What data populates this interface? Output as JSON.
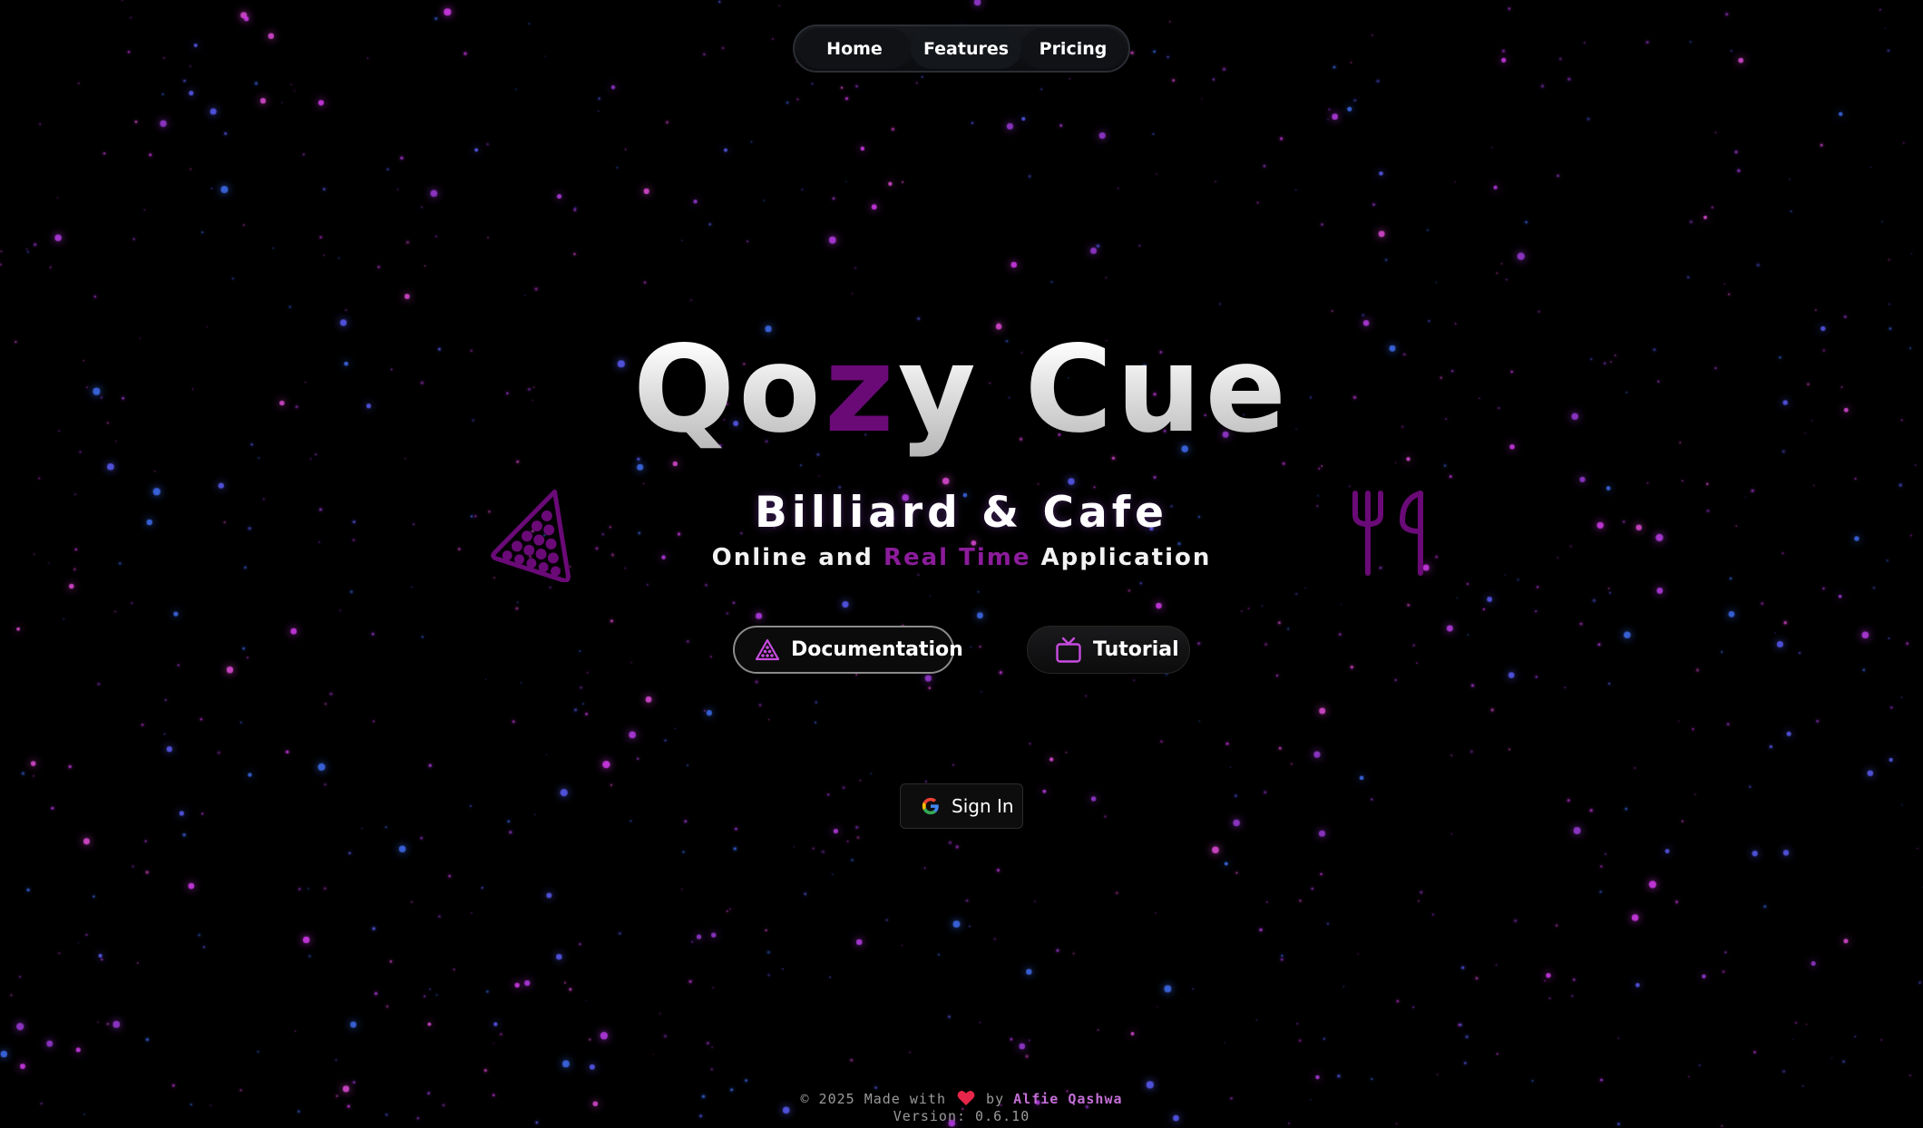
{
  "nav": {
    "items": [
      {
        "label": "Home"
      },
      {
        "label": "Features"
      },
      {
        "label": "Pricing"
      }
    ]
  },
  "hero": {
    "title_part1": "Qo",
    "title_accent": "z",
    "title_part2": "y Cue",
    "subtitle": "Billiard & Cafe",
    "tagline_pre": "Online and ",
    "tagline_accent": "Real Time",
    "tagline_post": " Application"
  },
  "buttons": {
    "documentation": "Documentation",
    "tutorial": "Tutorial",
    "sign_in": "Sign In"
  },
  "footer": {
    "copyright_pre": "© 2025 Made with",
    "by": "by",
    "author": "Alfie Qashwa",
    "version": "Version: 0.6.10"
  },
  "icons": {
    "rack": "billiard-rack-icon",
    "cutlery": "fork-knife-icon",
    "doc": "triangle-rack-icon",
    "tutorial": "tv-icon",
    "google": "google-g-icon",
    "heart": "heart-icon"
  },
  "colors": {
    "background": "#000000",
    "accent": "#6a0a77",
    "accent_light": "#c84ce0",
    "heart": "#e8264a"
  }
}
